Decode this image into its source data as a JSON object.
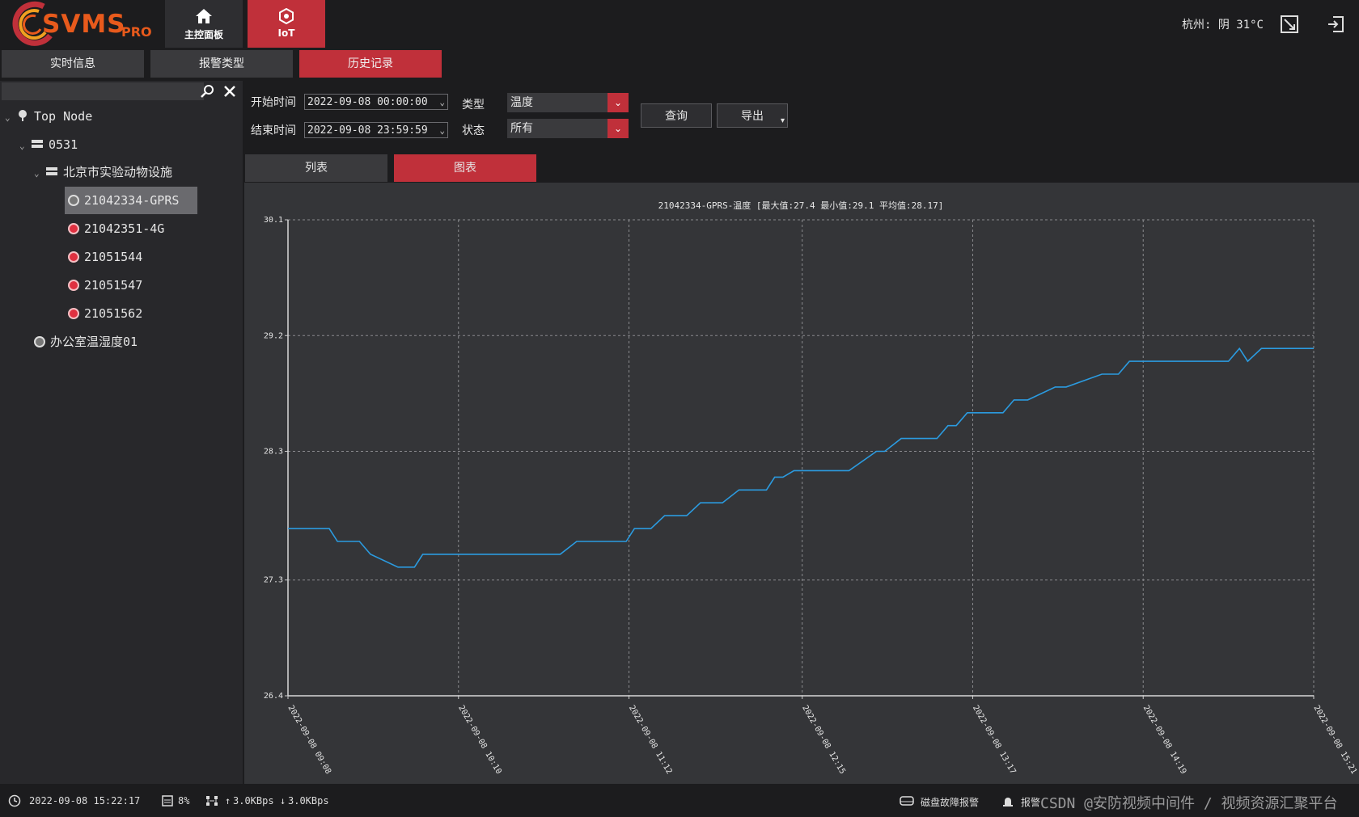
{
  "app": {
    "logo_text": "SVMS",
    "logo_sub": "PRO"
  },
  "nav": {
    "home_label": "主控面板",
    "iot_label": "IoT"
  },
  "header": {
    "weather": "杭州: 阴  31°C"
  },
  "subtabs": [
    "实时信息",
    "报警类型",
    "历史记录"
  ],
  "search": {
    "value": "",
    "placeholder": ""
  },
  "tree": {
    "root": "Top Node",
    "group": "0531",
    "site": "北京市实验动物设施",
    "devices": [
      "21042334-GPRS",
      "21042351-4G",
      "21051544",
      "21051547",
      "21051562"
    ],
    "other": "办公室温湿度01"
  },
  "filters": {
    "start_label": "开始时间",
    "start_value": "2022-09-08 00:00:00",
    "end_label": "结束时间",
    "end_value": "2022-09-08 23:59:59",
    "type_label": "类型",
    "type_value": "温度",
    "status_label": "状态",
    "status_value": "所有",
    "query_label": "查询",
    "export_label": "导出"
  },
  "view_tabs": {
    "list": "列表",
    "chart": "图表"
  },
  "colors": {
    "accent": "#c0303a",
    "line": "#2b9be0",
    "bg": "#1c1c1e",
    "panel": "#28282b",
    "chart_bg": "#343538"
  },
  "chart_data": {
    "type": "line",
    "title": "21042334-GPRS-温度 [最大值:27.4 最小值:29.1 平均值:28.17]",
    "ylim": [
      26.4,
      30.1
    ],
    "yticks": [
      "30.1",
      "29.2",
      "28.3",
      "27.3",
      "26.4"
    ],
    "xticks": [
      "2022-09-08 09:08",
      "2022-09-08 10:10",
      "2022-09-08 11:12",
      "2022-09-08 12:15",
      "2022-09-08 13:17",
      "2022-09-08 14:19",
      "2022-09-08 15:21"
    ],
    "grid": true,
    "series": [
      {
        "x": [
          "09:08",
          "09:23",
          "09:26",
          "09:34",
          "09:38",
          "09:48",
          "09:54",
          "09:57",
          "10:08",
          "10:47",
          "10:53",
          "11:08",
          "11:11",
          "11:14",
          "11:20",
          "11:25",
          "11:33",
          "11:38",
          "11:46",
          "11:52",
          "12:02",
          "12:05",
          "12:08",
          "12:12",
          "12:15",
          "12:32",
          "12:42",
          "12:45",
          "12:51",
          "13:04",
          "13:08",
          "13:11",
          "13:15",
          "13:28",
          "13:32",
          "13:37",
          "13:47",
          "13:51",
          "14:04",
          "14:10",
          "14:14",
          "14:23",
          "14:30",
          "14:50",
          "14:54",
          "14:57",
          "15:02",
          "15:08",
          "15:21"
        ],
        "values": [
          27.7,
          27.7,
          27.6,
          27.6,
          27.5,
          27.4,
          27.4,
          27.5,
          27.5,
          27.5,
          27.6,
          27.6,
          27.6,
          27.7,
          27.7,
          27.8,
          27.8,
          27.9,
          27.9,
          28.0,
          28.0,
          28.1,
          28.1,
          28.15,
          28.15,
          28.15,
          28.3,
          28.3,
          28.4,
          28.4,
          28.5,
          28.5,
          28.6,
          28.6,
          28.7,
          28.7,
          28.8,
          28.8,
          28.9,
          28.9,
          29.0,
          29.0,
          29.0,
          29.0,
          29.1,
          29.0,
          29.1,
          29.1,
          29.1
        ]
      }
    ]
  },
  "status": {
    "datetime": "2022-09-08 15:22:17",
    "cpu": "8%",
    "net_up": "3.0KBps",
    "net_down": "3.0KBps",
    "disk_alarm": "磁盘故障报警",
    "alarm": "报警",
    "watermark": "CSDN @安防视频中间件 / 视频资源汇聚平台"
  }
}
